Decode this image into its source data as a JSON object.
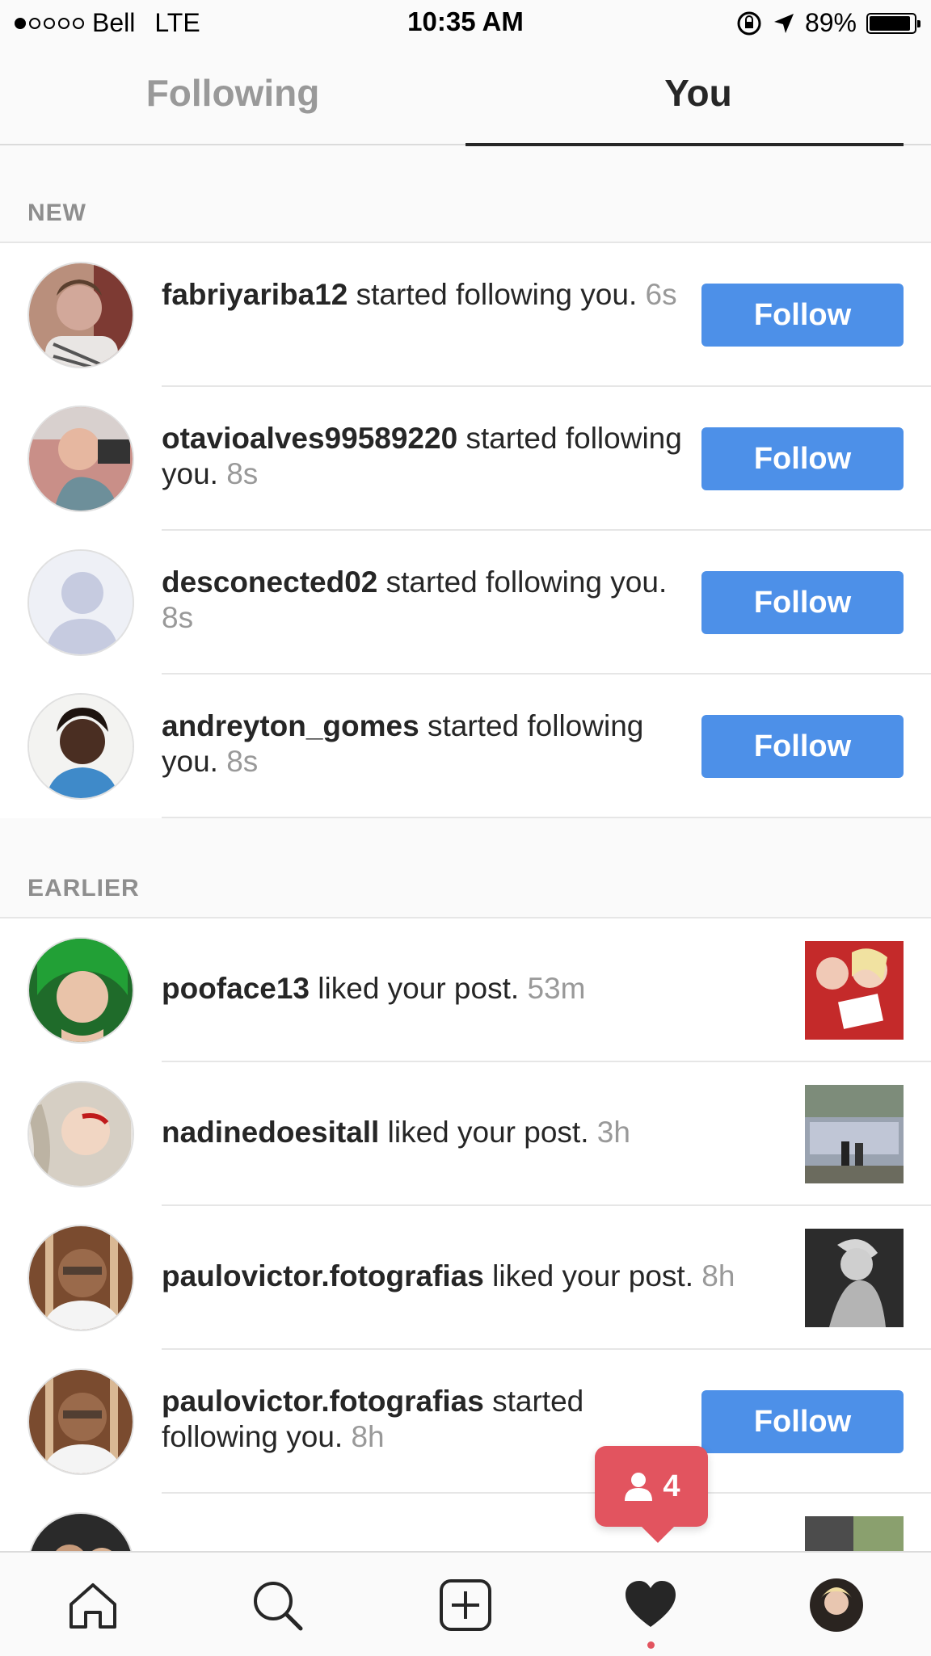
{
  "status_bar": {
    "carrier": "Bell",
    "network": "LTE",
    "time": "10:35 AM",
    "battery": "89%"
  },
  "tabs": {
    "following": "Following",
    "you": "You"
  },
  "sections": {
    "new": "NEW",
    "earlier": "EARLIER"
  },
  "new_items": [
    {
      "user": "fabriyariba12",
      "action": " started following you.",
      "time": "6s",
      "button": "Follow"
    },
    {
      "user": "otavioalves99589220",
      "action": " started following you.",
      "time": "8s",
      "button": "Follow"
    },
    {
      "user": "desconected02",
      "action": " started following you.",
      "time": "8s",
      "button": "Follow"
    },
    {
      "user": "andreyton_gomes",
      "action": " started following you.",
      "time": "8s",
      "button": "Follow"
    }
  ],
  "earlier_items": [
    {
      "user": "pooface13",
      "action": " liked your post.",
      "time": "53m"
    },
    {
      "user": "nadinedoesitall",
      "action": " liked your post.",
      "time": "3h"
    },
    {
      "user": "paulovictor.fotografias",
      "action": " liked your post.",
      "time": "8h"
    },
    {
      "user": "paulovictor.fotografias",
      "action": " started following you.",
      "time": "8h",
      "button": "Follow"
    }
  ],
  "badge": {
    "count": "4"
  },
  "colors": {
    "follow_blue": "#4d90e8",
    "badge_red": "#e2545f"
  },
  "tabbar_icons": [
    "home-icon",
    "search-icon",
    "add-post-icon",
    "activity-heart-icon",
    "profile-avatar"
  ]
}
